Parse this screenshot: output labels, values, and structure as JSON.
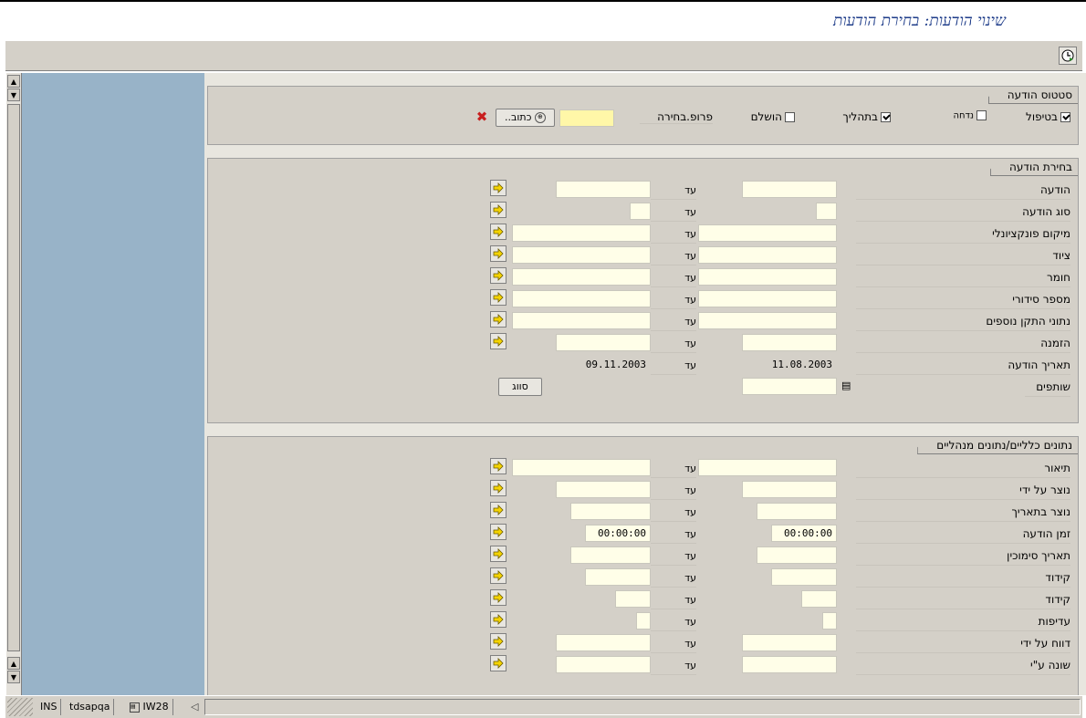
{
  "window": {
    "title": "שינוי הודעות: בחירת הודעות"
  },
  "toolbar": {
    "execute_icon": "clock-execute-icon"
  },
  "status_group": {
    "title": "סטטוס הודעה",
    "checkboxes": [
      {
        "label": "בטיפול",
        "checked": true
      },
      {
        "label": "נדחה",
        "checked": false
      },
      {
        "label": "בתהליך",
        "checked": true
      },
      {
        "label": "הושלם",
        "checked": false
      }
    ],
    "profile_label": "פרופ.בחירה",
    "profile_value": "",
    "address_button": "כתוב..",
    "delete_icon": "red-x-icon"
  },
  "selection_group": {
    "title": "בחירת הודעה",
    "until": "עד",
    "rows": [
      {
        "label": "הודעה",
        "from": "",
        "to": ""
      },
      {
        "label": "סוג הודעה",
        "from": "",
        "to": ""
      },
      {
        "label": "מיקום פונקציונלי",
        "from": "",
        "to": ""
      },
      {
        "label": "ציוד",
        "from": "",
        "to": ""
      },
      {
        "label": "חומר",
        "from": "",
        "to": ""
      },
      {
        "label": "מספר סידורי",
        "from": "",
        "to": ""
      },
      {
        "label": "נתוני התקן נוספים",
        "from": "",
        "to": ""
      },
      {
        "label": "הזמנה",
        "from": "",
        "to": ""
      },
      {
        "label": "תאריך הודעה",
        "from": "11.08.2003",
        "to": "09.11.2003"
      }
    ],
    "partners_label": "שותפים",
    "partners_value": "",
    "sort_button": "סווג"
  },
  "general_group": {
    "title": "נתונים כלליים/נתונים מנהליים",
    "until": "עד",
    "rows": [
      {
        "label": "תיאור",
        "from": "",
        "to": ""
      },
      {
        "label": "נוצר על ידי",
        "from": "",
        "to": ""
      },
      {
        "label": "נוצר בתאריך",
        "from": "",
        "to": ""
      },
      {
        "label": "זמן הודעה",
        "from": "00:00:00",
        "to": "00:00:00"
      },
      {
        "label": "תאריך סימוכין",
        "from": "",
        "to": ""
      },
      {
        "label": "קידוד",
        "from": "",
        "to": ""
      },
      {
        "label": "קידוד",
        "from": "",
        "to": ""
      },
      {
        "label": "עדיפות",
        "from": "",
        "to": ""
      },
      {
        "label": "דווח על ידי",
        "from": "",
        "to": ""
      },
      {
        "label": "שונה ע\"י",
        "from": "",
        "to": ""
      }
    ]
  },
  "statusbar": {
    "mode": "INS",
    "server": "tdsapqa",
    "transaction": "IW28"
  }
}
